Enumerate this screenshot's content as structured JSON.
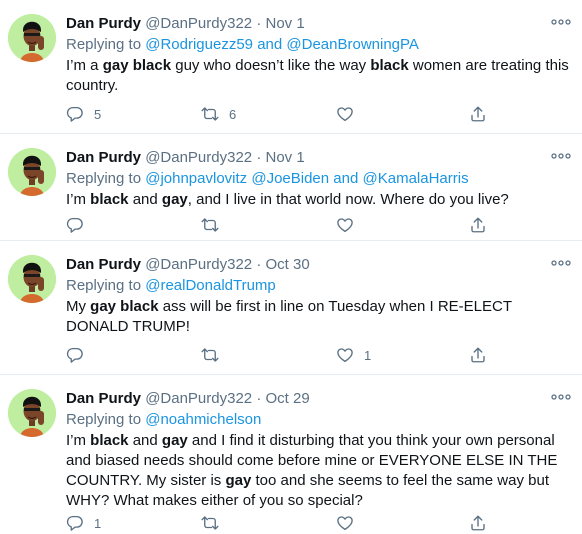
{
  "tweets": [
    {
      "name": "Dan Purdy",
      "handle": "@DanPurdy322",
      "separator": "·",
      "date": "Nov 1",
      "replying_prefix": "Replying to ",
      "replying": [
        "@Rodriguezz59",
        "and",
        "@DeanBrowningPA"
      ],
      "text_parts": [
        {
          "t": "I’m a ",
          "b": false
        },
        {
          "t": "gay black",
          "b": true
        },
        {
          "t": " guy who doesn’t like the way ",
          "b": false
        },
        {
          "t": "black",
          "b": true
        },
        {
          "t": " women are treating this country.",
          "b": false
        }
      ],
      "reply_count": "5",
      "retweet_count": "6",
      "like_count": ""
    },
    {
      "name": "Dan Purdy",
      "handle": "@DanPurdy322",
      "separator": "·",
      "date": "Nov 1",
      "replying_prefix": "Replying to ",
      "replying": [
        "@johnpavlovitz",
        "@JoeBiden",
        "and",
        "@KamalaHarris"
      ],
      "text_parts": [
        {
          "t": "I’m ",
          "b": false
        },
        {
          "t": "black",
          "b": true
        },
        {
          "t": " and ",
          "b": false
        },
        {
          "t": "gay",
          "b": true
        },
        {
          "t": ", and I live in that world now. Where do you live?",
          "b": false
        }
      ],
      "reply_count": "",
      "retweet_count": "",
      "like_count": ""
    },
    {
      "name": "Dan Purdy",
      "handle": "@DanPurdy322",
      "separator": "·",
      "date": "Oct 30",
      "replying_prefix": "Replying to ",
      "replying": [
        "@realDonaldTrump"
      ],
      "text_parts": [
        {
          "t": "My ",
          "b": false
        },
        {
          "t": "gay black",
          "b": true
        },
        {
          "t": " ass will be first in line on Tuesday when I RE-ELECT DONALD TRUMP!",
          "b": false
        }
      ],
      "reply_count": "",
      "retweet_count": "",
      "like_count": "1"
    },
    {
      "name": "Dan Purdy",
      "handle": "@DanPurdy322",
      "separator": "·",
      "date": "Oct 29",
      "replying_prefix": "Replying to ",
      "replying": [
        "@noahmichelson"
      ],
      "text_parts": [
        {
          "t": "I’m ",
          "b": false
        },
        {
          "t": "black",
          "b": true
        },
        {
          "t": " and ",
          "b": false
        },
        {
          "t": "gay",
          "b": true
        },
        {
          "t": " and I find it disturbing that you think your own personal and biased needs should come before mine or EVERYONE ELSE IN THE COUNTRY. My sister is ",
          "b": false
        },
        {
          "t": "gay",
          "b": true
        },
        {
          "t": " too and she seems to feel the same way but WHY? What makes either of you so special?",
          "b": false
        }
      ],
      "reply_count": "1",
      "retweet_count": "",
      "like_count": ""
    }
  ],
  "icons": {
    "reply": "reply-icon",
    "retweet": "retweet-icon",
    "like": "heart-icon",
    "share": "share-icon",
    "more": "more-options-icon",
    "avatar": "memoji-avatar"
  },
  "colors": {
    "name": "#0f1419",
    "muted": "#5b7083",
    "mention": "#1b95e0",
    "divider": "#e6ecf0",
    "avatar_bg": "#bfeea0"
  }
}
